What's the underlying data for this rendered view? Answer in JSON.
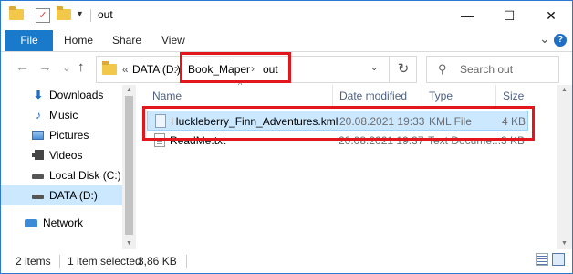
{
  "window": {
    "title": "out"
  },
  "window_buttons": {
    "minimize": "—",
    "maximize": "☐",
    "close": "✕"
  },
  "ribbon": {
    "file": "File",
    "tabs": [
      "Home",
      "Share",
      "View"
    ],
    "expand_glyph": "⌄",
    "help_glyph": "?"
  },
  "nav": {
    "back": "←",
    "forward": "→",
    "up": "↑",
    "recent": "⌄"
  },
  "address": {
    "overflow": "«",
    "crumbs": [
      "DATA (D:)",
      "Book_Maper",
      "out"
    ],
    "separator": "›",
    "dropdown": "⌄",
    "refresh": "↻"
  },
  "search": {
    "placeholder": "Search out",
    "icon": "search-icon"
  },
  "sidebar": {
    "items": [
      {
        "label": "Downloads",
        "icon": "download-icon"
      },
      {
        "label": "Music",
        "icon": "music-icon"
      },
      {
        "label": "Pictures",
        "icon": "pictures-icon"
      },
      {
        "label": "Videos",
        "icon": "videos-icon"
      },
      {
        "label": "Local Disk (C:)",
        "icon": "drive-icon"
      },
      {
        "label": "DATA (D:)",
        "icon": "drive-icon",
        "selected": true
      },
      {
        "label": "Network",
        "icon": "network-icon"
      }
    ]
  },
  "columns": {
    "name": "Name",
    "date": "Date modified",
    "type": "Type",
    "size": "Size",
    "sort": "^"
  },
  "files": [
    {
      "name": "Huckleberry_Finn_Adventures.kml",
      "date": "20.08.2021 19:33",
      "type": "KML File",
      "size": "4 KB",
      "selected": true
    },
    {
      "name": "ReadMe.txt",
      "date": "20.08.2021 19:37",
      "type": "Text Docume...",
      "size": "3 KB",
      "selected": false
    }
  ],
  "status": {
    "items": "2 items",
    "selected": "1 item selected",
    "size": "3,86 KB"
  },
  "colors": {
    "accent": "#1979ca",
    "highlight_box": "#e2161d",
    "selection": "#cce8ff"
  }
}
